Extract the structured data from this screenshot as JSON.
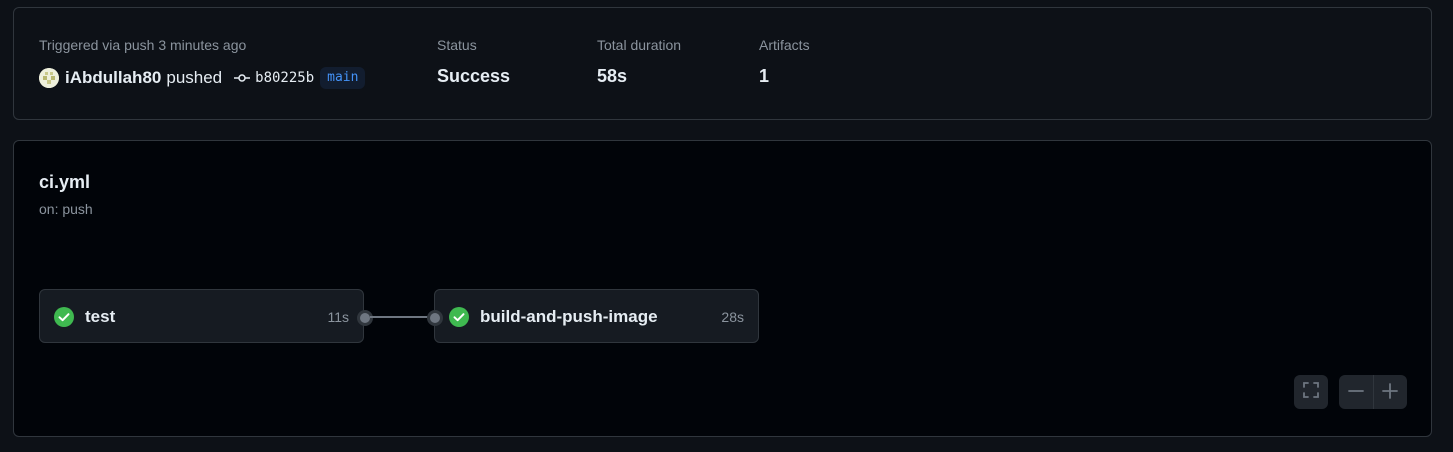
{
  "run_summary": {
    "trigger_text": "Triggered via push 3 minutes ago",
    "actor": "iAbdullah80",
    "action": "pushed",
    "commit_sha": "b80225b",
    "branch": "main",
    "status_label": "Status",
    "status_value": "Success",
    "duration_label": "Total duration",
    "duration_value": "58s",
    "artifacts_label": "Artifacts",
    "artifacts_value": "1"
  },
  "workflow": {
    "name": "ci.yml",
    "trigger": "on: push",
    "jobs": [
      {
        "name": "test",
        "duration": "11s",
        "status": "success"
      },
      {
        "name": "build-and-push-image",
        "duration": "28s",
        "status": "success"
      }
    ]
  },
  "controls": {
    "fullscreen_icon": "fullscreen-icon",
    "zoom_out_icon": "minus-icon",
    "zoom_in_icon": "plus-icon"
  },
  "colors": {
    "success": "#3fb950",
    "link": "#4493f8",
    "muted": "#8b949e"
  }
}
